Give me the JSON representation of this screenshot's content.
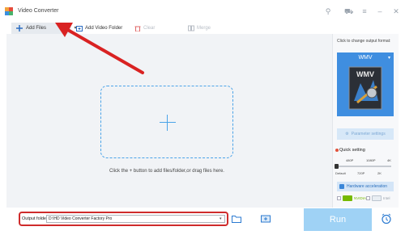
{
  "app": {
    "title": "Video Converter"
  },
  "toolbar": {
    "add_files": "Add Files",
    "add_folder": "Add Video Folder",
    "clear": "Clear",
    "merge": "Merge"
  },
  "workspace": {
    "hint": "Click the + button to add files/folder,or drag files here."
  },
  "format_panel": {
    "label": "Click to change output format:",
    "format": "WMV",
    "format_icon_text": "WMV",
    "param_settings": "Parameter settings",
    "quick_setting": "Quick setting",
    "ticks_top": [
      "480P",
      "1080P",
      "4K"
    ],
    "ticks_bottom": [
      "Default",
      "720P",
      "2K"
    ],
    "quality_level": 0,
    "hw_accel": "Hardware acceleration",
    "gpu1": "NVIDIA",
    "gpu2": "Intel"
  },
  "output": {
    "label": "Output folder:",
    "path": "D:\\HD Video Converter Factory Pro"
  },
  "actions": {
    "run": "Run"
  },
  "colors": {
    "accent": "#3f8ee0",
    "highlight": "#cf2b2b",
    "run": "#9fd2f5"
  }
}
